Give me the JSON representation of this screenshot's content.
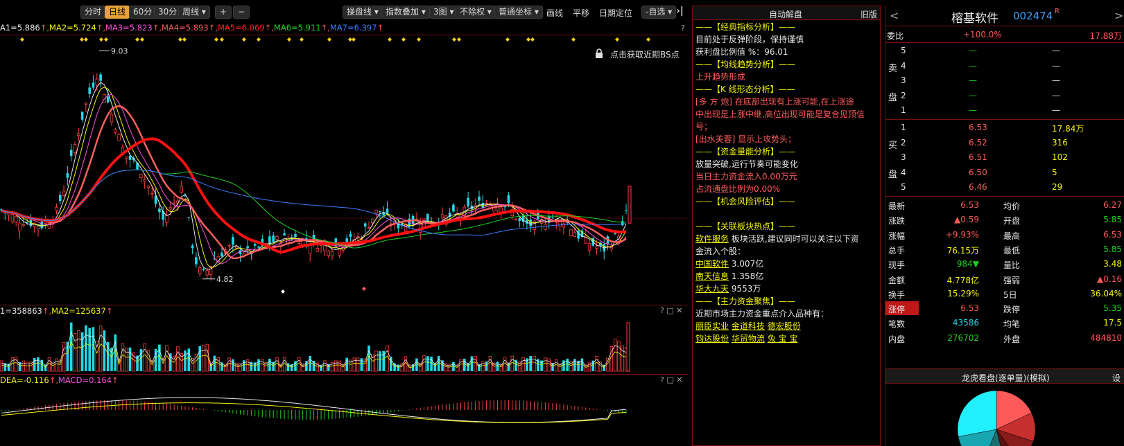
{
  "toolbar": {
    "periods": [
      "分时",
      "日线",
      "60分",
      "30分",
      "周线"
    ],
    "active_period": "日线",
    "zoom_in": "+",
    "zoom_out": "−",
    "buttons": [
      "操盘线",
      "指数叠加",
      "3图",
      "不除权",
      "普通坐标"
    ],
    "plain": [
      "画线",
      "平移",
      "日期定位",
      "-自选"
    ],
    "collapse": "K"
  },
  "ma_legend": [
    {
      "text": "A1=5.886",
      "color": "#e8e8e8"
    },
    {
      "text": "MA2=5.724",
      "color": "#f4f40a"
    },
    {
      "text": "MA3=5.823",
      "color": "#ff4fe0"
    },
    {
      "text": "MA4=5.893",
      "color": "#ff5a5a"
    },
    {
      "text": "MA5=6.069",
      "color": "#ff2020"
    },
    {
      "text": "MA6=5.911",
      "color": "#1ed21e"
    },
    {
      "text": "MA7=6.397",
      "color": "#3a7bff"
    }
  ],
  "price_labels": {
    "high": "9.03",
    "low": "4.82"
  },
  "lock_hint": "点击获取近期BS点",
  "vol_legend": [
    {
      "text": "1=358863",
      "color": "#e8e8e8"
    },
    {
      "text": "MA2=125637",
      "color": "#f4f40a"
    }
  ],
  "macd_legend": [
    {
      "text": "DEA=-0.116",
      "color": "#f4f40a"
    },
    {
      "text": "MACD=0.164",
      "color": "#ff4fe0"
    }
  ],
  "pane_icons": "? □ ✕",
  "analysis": {
    "title": "自动解盘",
    "old_version": "旧版",
    "s1_head": "——【经典指标分析】——",
    "s1_l1": "目前处于反弹阶段，保持谨慎",
    "s1_l2": "获利盘比例值 %：96.01",
    "s2_head": "——【均线趋势分析】——",
    "s2_l1": "上升趋势形成",
    "s3_head": "——【K 线形态分析】——",
    "s3_l1": "[多 方 炮] 在底部出现有上涨可能,在上涨途",
    "s3_l2": "中出现是上涨中继,高位出现可能是复合见顶信",
    "s3_l3": "号；",
    "s3_l4": "[出水芙蓉] 显示上攻势头；",
    "s4_head": "——【资金量能分析】——",
    "s4_l1": "放量突破,运行节奏可能变化",
    "s4_l2": "当日主力资金流入0.00万元",
    "s4_l3": "占流通盘比例为0.00%",
    "s5_head": "——【机会风险评估】——",
    "s6_head": "——【关联板块热点】——",
    "s6_link": "软件服务",
    "s6_l1_rest": "板块活跃,建议同时可以关注以下资",
    "s6_l2": "金流入个股：",
    "stocks": [
      {
        "name": "中国软件",
        "value": "3.007亿"
      },
      {
        "name": "南天信息",
        "value": "1.358亿"
      },
      {
        "name": "华大九天",
        "value": "9553万"
      }
    ],
    "s7_head": "——【主力资金聚焦】——",
    "s7_l1": "近期市场主力资金重点介入品种有：",
    "focus_row1": [
      "丽臣实业",
      "金道科技",
      "德宏股份"
    ],
    "focus_row2": [
      "钧达股份",
      "华贸物流",
      "兔 宝 宝"
    ]
  },
  "quote": {
    "name": "榕基软件",
    "code": "002474",
    "flag": "R",
    "prev": "<",
    "next": ">",
    "weibi_label": "委比",
    "weibi_pct": "+100.0%",
    "weibi_vol": "17.88万",
    "sell_label": [
      "卖",
      "盘"
    ],
    "buy_label": [
      "买",
      "盘"
    ],
    "sell": [
      {
        "lvl": "5",
        "price": "—",
        "vol": "—"
      },
      {
        "lvl": "4",
        "price": "—",
        "vol": "—"
      },
      {
        "lvl": "3",
        "price": "—",
        "vol": "—"
      },
      {
        "lvl": "2",
        "price": "—",
        "vol": "—"
      },
      {
        "lvl": "1",
        "price": "—",
        "vol": "—"
      }
    ],
    "buy": [
      {
        "lvl": "1",
        "price": "6.53",
        "vol": "17.84万"
      },
      {
        "lvl": "2",
        "price": "6.52",
        "vol": "316"
      },
      {
        "lvl": "3",
        "price": "6.51",
        "vol": "102"
      },
      {
        "lvl": "4",
        "price": "6.50",
        "vol": "5"
      },
      {
        "lvl": "5",
        "price": "6.46",
        "vol": "29"
      }
    ],
    "stats": [
      {
        "l1": "最新",
        "v1": "6.53",
        "c1": "#ff5a5a",
        "l2": "均价",
        "v2": "6.27",
        "c2": "#ff5a5a"
      },
      {
        "l1": "涨跌",
        "v1": "▲0.59",
        "c1": "#ff5a5a",
        "l2": "开盘",
        "v2": "5.85",
        "c2": "#1ed21e"
      },
      {
        "l1": "涨幅",
        "v1": "+9.93%",
        "c1": "#ff5a5a",
        "l2": "最高",
        "v2": "6.53",
        "c2": "#ff5a5a"
      },
      {
        "l1": "总手",
        "v1": "76.15万",
        "c1": "#f4f40a",
        "l2": "最低",
        "v2": "5.85",
        "c2": "#1ed21e"
      },
      {
        "l1": "现手",
        "v1": "984▼",
        "c1": "#1ed21e",
        "l2": "量比",
        "v2": "3.48",
        "c2": "#f4f40a"
      },
      {
        "l1": "金额",
        "v1": "4.778亿",
        "c1": "#f4f40a",
        "l2": "强弱",
        "v2": "▲0.16",
        "c2": "#ff5a5a"
      },
      {
        "l1": "换手",
        "v1": "15.29%",
        "c1": "#f4f40a",
        "l2": "5日",
        "v2": "36.04%",
        "c2": "#f4f40a"
      },
      {
        "l1": "涨停",
        "v1": "6.53",
        "c1": "#ff5a5a",
        "l2": "跌停",
        "v2": "5.35",
        "c2": "#1ed21e"
      },
      {
        "l1": "笔数",
        "v1": "43586",
        "c1": "#22d8e8",
        "l2": "均笔",
        "v2": "17.5",
        "c2": "#f4f40a"
      },
      {
        "l1": "内盘",
        "v1": "276702",
        "c1": "#1ed21e",
        "l2": "外盘",
        "v2": "484810",
        "c2": "#ff5a5a"
      }
    ],
    "lhk_title": "龙虎看盘(逐单量)(模拟)",
    "lhk_set": "设"
  }
}
